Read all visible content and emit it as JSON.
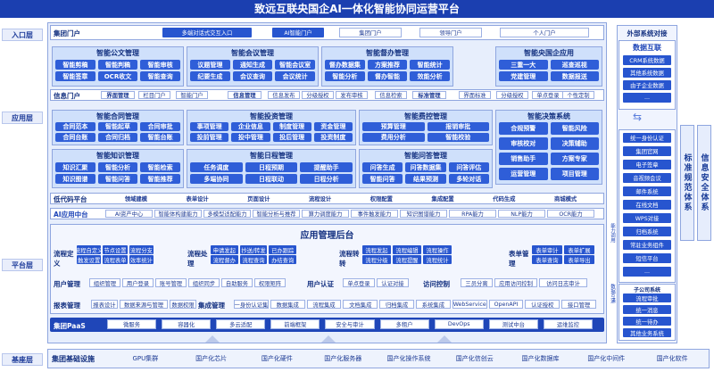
{
  "title": "致远互联央国企AI一体化智能协同运营平台",
  "layers": {
    "entry": "入口层",
    "app": "应用层",
    "platform": "平台层",
    "base": "基座层"
  },
  "portal": {
    "label": "集团门户",
    "items": [
      "多端对话式交互入口",
      "AI智能门户",
      "集团门户",
      "领导门户",
      "个人门户"
    ]
  },
  "modules_top": [
    {
      "title": "智能公文管理",
      "items": [
        "智能剪稿",
        "智能判稿",
        "智能审核",
        "智能签章",
        "OCR收文",
        "智能查询"
      ]
    },
    {
      "title": "智能会议管理",
      "items": [
        "议题管理",
        "通知生成",
        "智能会议室",
        "纪要生成",
        "会议查询",
        "会议统计"
      ]
    },
    {
      "title": "智能督办管理",
      "items": [
        "督办数据集",
        "方案推荐",
        "智能统计",
        "智能分析",
        "督办智能",
        "效能分析"
      ]
    },
    {
      "title": "智能央国企应用",
      "items": [
        "三重一大",
        "巡查巡视",
        "党建管理",
        "数据报送"
      ]
    }
  ],
  "info_portal": {
    "label": "信息门户",
    "items": [
      "界面管理",
      "栏目门户",
      "智能门户",
      "信息管理",
      "信息发布",
      "分级授权",
      "发布审核",
      "信息检索",
      "标准管理",
      "界面标准",
      "分级授权",
      "单点登录",
      "个性定制"
    ]
  },
  "modules_mid": [
    {
      "title": "智能合同管理",
      "items": [
        "合同范本",
        "智能起草",
        "合同审批",
        "合同台账",
        "合同归档",
        "智能台账"
      ]
    },
    {
      "title": "智能投资管理",
      "items": [
        "事项管理",
        "企业信息",
        "制度管理",
        "资金管理",
        "投前管理",
        "投中管理",
        "投后管理",
        "投资制度"
      ]
    },
    {
      "title": "智能费控管理",
      "items": [
        "预算管理",
        "报销审批",
        "费用分析",
        "智能校验"
      ]
    },
    {
      "title": "智能决策系统",
      "items": [
        "合规预警",
        "智能风险",
        "审核校对",
        "决策辅助",
        "销售助手",
        "方案专家",
        "运营管理",
        "项目管理"
      ]
    }
  ],
  "modules_low": [
    {
      "title": "智能知识管理",
      "items": [
        "知识汇聚",
        "智能分析",
        "智能检索",
        "知识图谱",
        "智能问答",
        "智能推荐"
      ]
    },
    {
      "title": "智能日程管理",
      "items": [
        "任务调度",
        "日程预期",
        "提醒助手",
        "多端协同",
        "日程联动",
        "日程分析"
      ]
    },
    {
      "title": "智能问答管理",
      "items": [
        "问答生成",
        "问答数据集",
        "问答评估",
        "智能问答",
        "结果预测",
        "多轮对话"
      ]
    }
  ],
  "lowcode": {
    "label": "低代码平台",
    "items": [
      "领域建模",
      "表单设计",
      "页面设计",
      "流程设计",
      "权限配置",
      "集成配置",
      "代码生成",
      "商城模式"
    ]
  },
  "ai_center": {
    "label": "AI应用中台",
    "items": [
      "AI资产中心",
      "智能体构建能力",
      "多模型适配能力",
      "智能分析与推荐",
      "算力调度能力",
      "事件触发能力",
      "知识图谱能力",
      "RPA能力",
      "NLP能力",
      "OCR能力"
    ]
  },
  "backend": {
    "title": "应用管理后台",
    "process": {
      "label": "流程定义",
      "items": [
        "流程自定义",
        "节点设置",
        "流程分支",
        "触发设置",
        "流程表单",
        "效率统计"
      ]
    },
    "flow": {
      "label": "流程处理",
      "items": [
        "申请发起",
        "抄送/转发",
        "已办跟踪",
        "流程督办",
        "流程查询",
        "办结查询"
      ]
    },
    "convert": {
      "label": "流程转转",
      "items": [
        "流程发起",
        "流程编辑",
        "流程操作",
        "流程分级",
        "流程提醒",
        "流程统计"
      ]
    },
    "form": {
      "label": "表单管理",
      "items": [
        "表单审计",
        "表单扩展",
        "表单查询",
        "表单导出"
      ]
    },
    "user": {
      "label": "用户管理",
      "items": [
        "组织管理",
        "用户登录",
        "账号管理",
        "组织同步",
        "自助服务",
        "权限矩阵"
      ]
    },
    "auth": {
      "label": "用户认证",
      "items": [
        "单点登录",
        "认证对接"
      ]
    },
    "access": {
      "label": "访问控制",
      "items": [
        "三员分离",
        "应用访问控制",
        "访问日志审计"
      ]
    },
    "report": {
      "label": "报表管理",
      "items": [
        "报表设计",
        "数据来源与管理",
        "数据权限"
      ]
    },
    "integration": {
      "label": "集成管理",
      "items": [
        "统一身份认证集成",
        "数据集成",
        "流程集成",
        "文档集成",
        "归档集成",
        "系统集成",
        "WebService",
        "OpenAPI",
        "认证授权",
        "接口管理"
      ]
    }
  },
  "paas": {
    "label": "集团PaaS",
    "items": [
      "微服务",
      "容器化",
      "多云适配",
      "前端框架",
      "安全与审计",
      "多租户",
      "DevOps",
      "测试中台",
      "运维监控"
    ]
  },
  "base": {
    "label": "集团基础设施",
    "items": [
      "GPU集群",
      "国产化芯片",
      "国产化硬件",
      "国产化服务器",
      "国产化操作系统",
      "国产化信创云",
      "国产化数据库",
      "国产化中间件",
      "国产化软件"
    ]
  },
  "external": {
    "title": "外部系统对接",
    "datalink": "数据互联",
    "datalink_items": [
      "CRM系统数据",
      "其他系统数据",
      "由子企业数据",
      "..."
    ],
    "items": [
      "统一身份认证",
      "集团官网",
      "电子签章",
      "音视频会议",
      "邮件系统",
      "在线文档",
      "WPS对接",
      "归档系统",
      "常驻业务组件",
      "短信平台",
      "..."
    ],
    "group_title": "子公司系统",
    "group_items": [
      "流程审批",
      "统一消息",
      "统一待办",
      "其他业务系统"
    ]
  },
  "side_label_a": "标准规范体系",
  "side_label_b": "信息安全体系",
  "side_tag_ai": "能力调用",
  "side_tag_data": "数据互通"
}
